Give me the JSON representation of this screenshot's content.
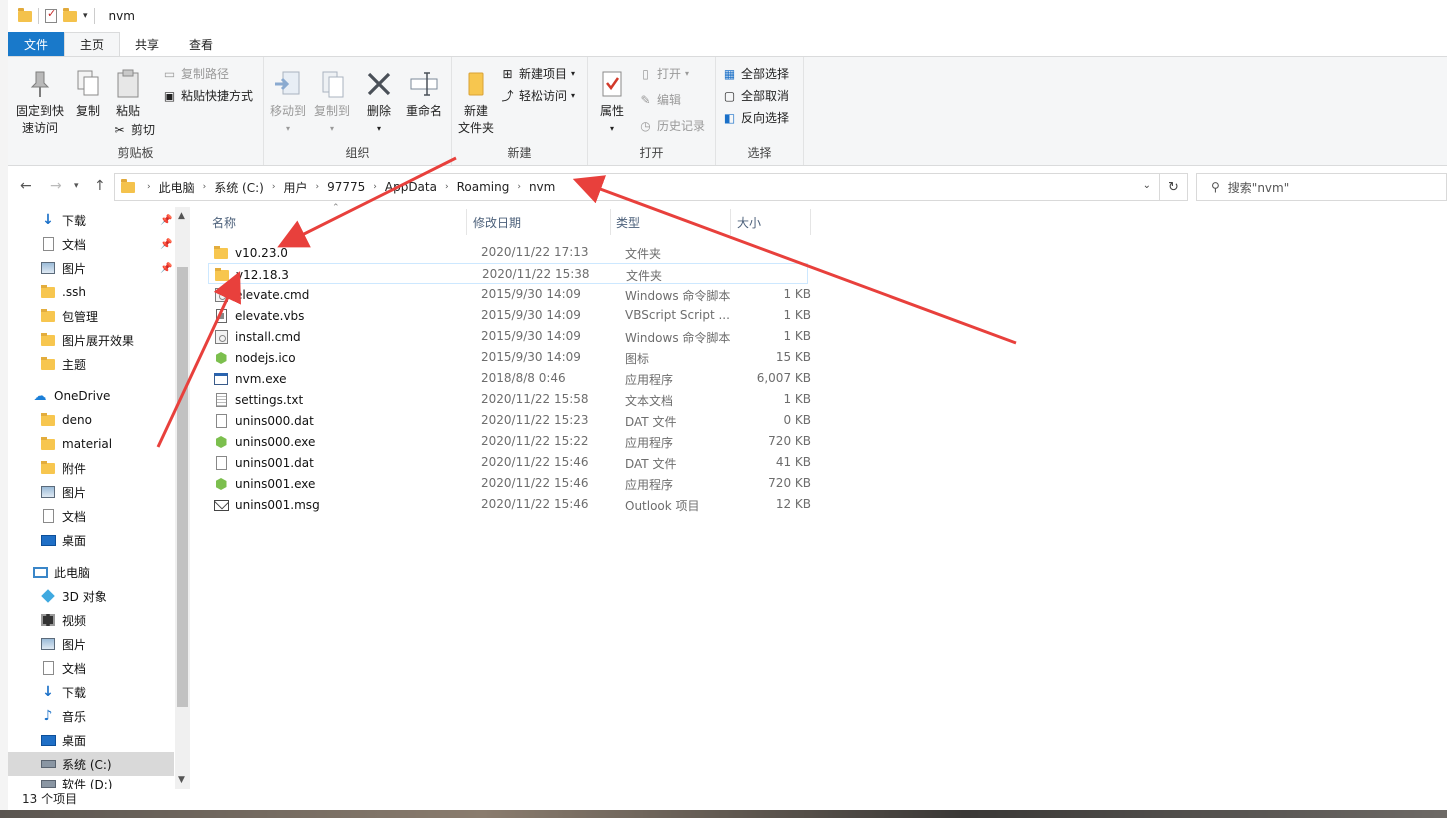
{
  "window": {
    "title": "nvm"
  },
  "tabs": [
    {
      "label": "文件"
    },
    {
      "label": "主页"
    },
    {
      "label": "共享"
    },
    {
      "label": "查看"
    }
  ],
  "ribbon": {
    "clipboard": {
      "group": "剪贴板",
      "pin_line1": "固定到快",
      "pin_line2": "速访问",
      "copy": "复制",
      "paste": "粘贴",
      "copy_path": "复制路径",
      "paste_shortcut": "粘贴快捷方式",
      "cut": "剪切"
    },
    "organize": {
      "group": "组织",
      "move_to": "移动到",
      "copy_to": "复制到",
      "delete": "删除",
      "rename": "重命名"
    },
    "new": {
      "group": "新建",
      "new_folder_line1": "新建",
      "new_folder_line2": "文件夹",
      "new_item": "新建项目",
      "easy_access": "轻松访问"
    },
    "open": {
      "group": "打开",
      "properties": "属性",
      "open": "打开",
      "edit": "编辑",
      "history": "历史记录"
    },
    "select": {
      "group": "选择",
      "select_all": "全部选择",
      "select_none": "全部取消",
      "invert": "反向选择"
    }
  },
  "address": {
    "crumbs": [
      "此电脑",
      "系统 (C:)",
      "用户",
      "97775",
      "AppData",
      "Roaming",
      "nvm"
    ],
    "search_placeholder": "搜索\"nvm\""
  },
  "nav": {
    "items": [
      {
        "label": "下载",
        "icon": "download-icon",
        "pinned": true
      },
      {
        "label": "文档",
        "icon": "document-icon",
        "pinned": true
      },
      {
        "label": "图片",
        "icon": "pictures-icon",
        "pinned": true
      },
      {
        "label": ".ssh",
        "icon": "folder-icon"
      },
      {
        "label": "包管理",
        "icon": "folder-icon"
      },
      {
        "label": "图片展开效果",
        "icon": "folder-icon"
      },
      {
        "label": "主题",
        "icon": "folder-icon"
      },
      {
        "label": "OneDrive",
        "icon": "onedrive-icon"
      },
      {
        "label": "deno",
        "icon": "folder-icon"
      },
      {
        "label": "material",
        "icon": "folder-icon"
      },
      {
        "label": "附件",
        "icon": "folder-icon"
      },
      {
        "label": "图片",
        "icon": "pictures-icon"
      },
      {
        "label": "文档",
        "icon": "document-icon"
      },
      {
        "label": "桌面",
        "icon": "desktop-icon"
      },
      {
        "label": "此电脑",
        "icon": "this-pc-icon"
      },
      {
        "label": "3D 对象",
        "icon": "3d-objects-icon"
      },
      {
        "label": "视频",
        "icon": "video-icon"
      },
      {
        "label": "图片",
        "icon": "pictures-icon"
      },
      {
        "label": "文档",
        "icon": "document-icon"
      },
      {
        "label": "下载",
        "icon": "download-icon"
      },
      {
        "label": "音乐",
        "icon": "music-icon"
      },
      {
        "label": "桌面",
        "icon": "desktop-icon"
      },
      {
        "label": "系统 (C:)",
        "icon": "drive-icon",
        "selected": true
      },
      {
        "label": "软件 (D:)",
        "icon": "drive-icon"
      }
    ]
  },
  "columns": {
    "name": "名称",
    "date": "修改日期",
    "type": "类型",
    "size": "大小"
  },
  "files": [
    {
      "name": "v10.23.0",
      "date": "2020/11/22 17:13",
      "type": "文件夹",
      "size": "",
      "icon": "folder-icon"
    },
    {
      "name": "v12.18.3",
      "date": "2020/11/22 15:38",
      "type": "文件夹",
      "size": "",
      "icon": "folder-icon"
    },
    {
      "name": "elevate.cmd",
      "date": "2015/9/30 14:09",
      "type": "Windows 命令脚本",
      "size": "1 KB",
      "icon": "cmd-icon"
    },
    {
      "name": "elevate.vbs",
      "date": "2015/9/30 14:09",
      "type": "VBScript Script ...",
      "size": "1 KB",
      "icon": "vbs-icon"
    },
    {
      "name": "install.cmd",
      "date": "2015/9/30 14:09",
      "type": "Windows 命令脚本",
      "size": "1 KB",
      "icon": "cmd-icon"
    },
    {
      "name": "nodejs.ico",
      "date": "2015/9/30 14:09",
      "type": "图标",
      "size": "15 KB",
      "icon": "nodejs-icon"
    },
    {
      "name": "nvm.exe",
      "date": "2018/8/8 0:46",
      "type": "应用程序",
      "size": "6,007 KB",
      "icon": "exe-icon"
    },
    {
      "name": "settings.txt",
      "date": "2020/11/22 15:58",
      "type": "文本文档",
      "size": "1 KB",
      "icon": "text-icon"
    },
    {
      "name": "unins000.dat",
      "date": "2020/11/22 15:23",
      "type": "DAT 文件",
      "size": "0 KB",
      "icon": "dat-icon"
    },
    {
      "name": "unins000.exe",
      "date": "2020/11/22 15:22",
      "type": "应用程序",
      "size": "720 KB",
      "icon": "nodejs-icon"
    },
    {
      "name": "unins001.dat",
      "date": "2020/11/22 15:46",
      "type": "DAT 文件",
      "size": "41 KB",
      "icon": "dat-icon"
    },
    {
      "name": "unins001.exe",
      "date": "2020/11/22 15:46",
      "type": "应用程序",
      "size": "720 KB",
      "icon": "nodejs-icon"
    },
    {
      "name": "unins001.msg",
      "date": "2020/11/22 15:46",
      "type": "Outlook 项目",
      "size": "12 KB",
      "icon": "mail-icon"
    }
  ],
  "status": {
    "count": "13 个项目"
  },
  "colors": {
    "file_tab": "#1979ca",
    "annotation_arrow": "#e8403c",
    "selection": "#d9d9d9"
  }
}
